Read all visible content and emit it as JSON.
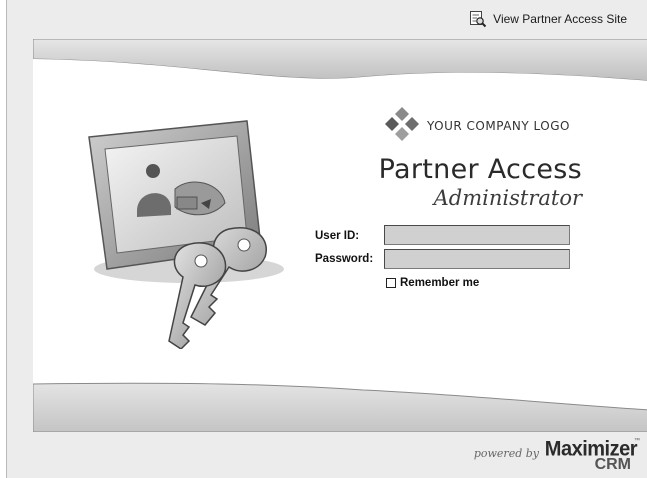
{
  "header": {
    "partner_site_link": "View Partner Access Site",
    "link_icon": "magnifier-document-icon"
  },
  "logo": {
    "text": "YOUR COMPANY LOGO",
    "icon": "diamond-cluster-logo"
  },
  "title": {
    "line1": "Partner Access",
    "line2": "Administrator"
  },
  "form": {
    "user_id_label": "User ID:",
    "user_id_value": "",
    "password_label": "Password:",
    "password_value": "",
    "remember_label": "Remember me",
    "remember_checked": false
  },
  "footer": {
    "powered_by": "powered by",
    "brand": "Maximizer",
    "brand_sub": "CRM",
    "trademark": "™"
  },
  "colors": {
    "background": "#ececec",
    "panel": "#ffffff",
    "field": "#d0d0d0",
    "band": "#d4d4d4"
  }
}
